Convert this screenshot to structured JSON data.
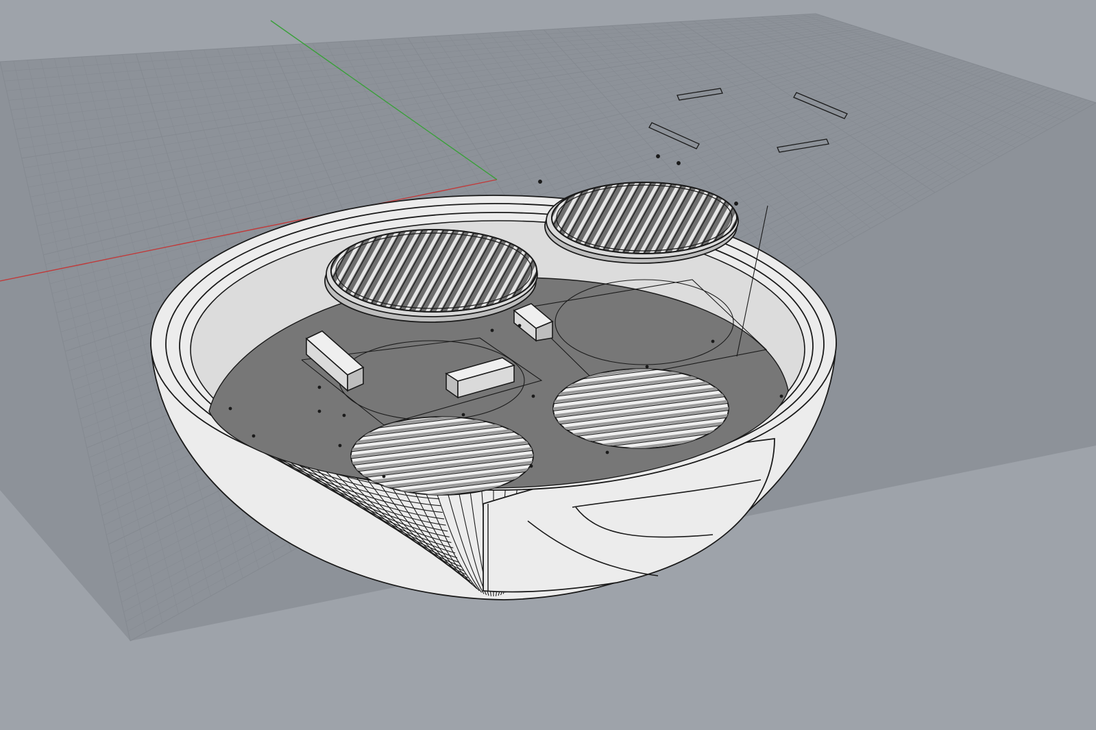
{
  "viewport": {
    "projection": "perspective",
    "display_mode": "shaded",
    "background_color": "#9ea3aa",
    "grid_color": "#8d9299",
    "grid_line_color": "#858a91",
    "x_axis_color": "#c03a3a",
    "y_axis_color": "#3aa03a"
  },
  "scene": {
    "model": {
      "object_type": "bowl-enclosure",
      "fill_color": "#ececec",
      "floor_color": "#777777",
      "outline_color": "#1a1a1a"
    },
    "objects": [
      {
        "type": "grille-disc"
      },
      {
        "type": "grille-disc"
      },
      {
        "type": "grille-cutout"
      },
      {
        "type": "grille-cutout"
      },
      {
        "type": "standoff-block"
      },
      {
        "type": "standoff-block"
      },
      {
        "type": "standoff-block"
      },
      {
        "type": "slot-outline"
      },
      {
        "type": "slot-outline"
      },
      {
        "type": "slot-outline"
      },
      {
        "type": "slot-outline"
      }
    ]
  }
}
